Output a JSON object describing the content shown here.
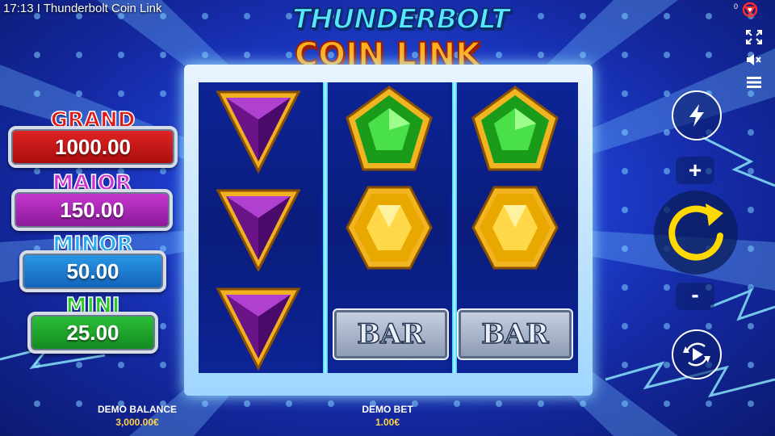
{
  "status_bar": {
    "time_title": "17:13 I Thunderbolt Coin Link",
    "corner_count": "0"
  },
  "logo": {
    "line1": "THUNDERBOLT",
    "line2": "COIN LINK"
  },
  "jackpots": [
    {
      "name": "GRAND",
      "value": "1000.00",
      "label_color": "#e01818",
      "box_color": "#c01010"
    },
    {
      "name": "MAJOR",
      "value": "150.00",
      "label_color": "#d030d8",
      "box_color": "#a020b0"
    },
    {
      "name": "MINOR",
      "value": "50.00",
      "label_color": "#2aa8f0",
      "box_color": "#1a78c8"
    },
    {
      "name": "MINI",
      "value": "25.00",
      "label_color": "#28c828",
      "box_color": "#189a28"
    }
  ],
  "reels": [
    [
      "purple-triangle-gem",
      "purple-triangle-gem",
      "purple-triangle-gem"
    ],
    [
      "green-pentagon-gem",
      "yellow-hexagon-gem",
      "bar-symbol"
    ],
    [
      "green-pentagon-gem",
      "yellow-hexagon-gem",
      "bar-symbol"
    ]
  ],
  "bar_label": "BAR",
  "controls": {
    "turbo_icon": "lightning-icon",
    "plus_label": "+",
    "minus_label": "-",
    "spin_icon": "spin-refresh-icon",
    "autoplay_icon": "autoplay-icon",
    "fullscreen_icon": "fullscreen-icon",
    "mute_icon": "sound-muted-icon",
    "menu_icon": "hamburger-menu-icon"
  },
  "footer": {
    "balance_label": "DEMO BALANCE",
    "balance_value": "3,000.00€",
    "bet_label": "DEMO BET",
    "bet_value": "1.00€"
  }
}
